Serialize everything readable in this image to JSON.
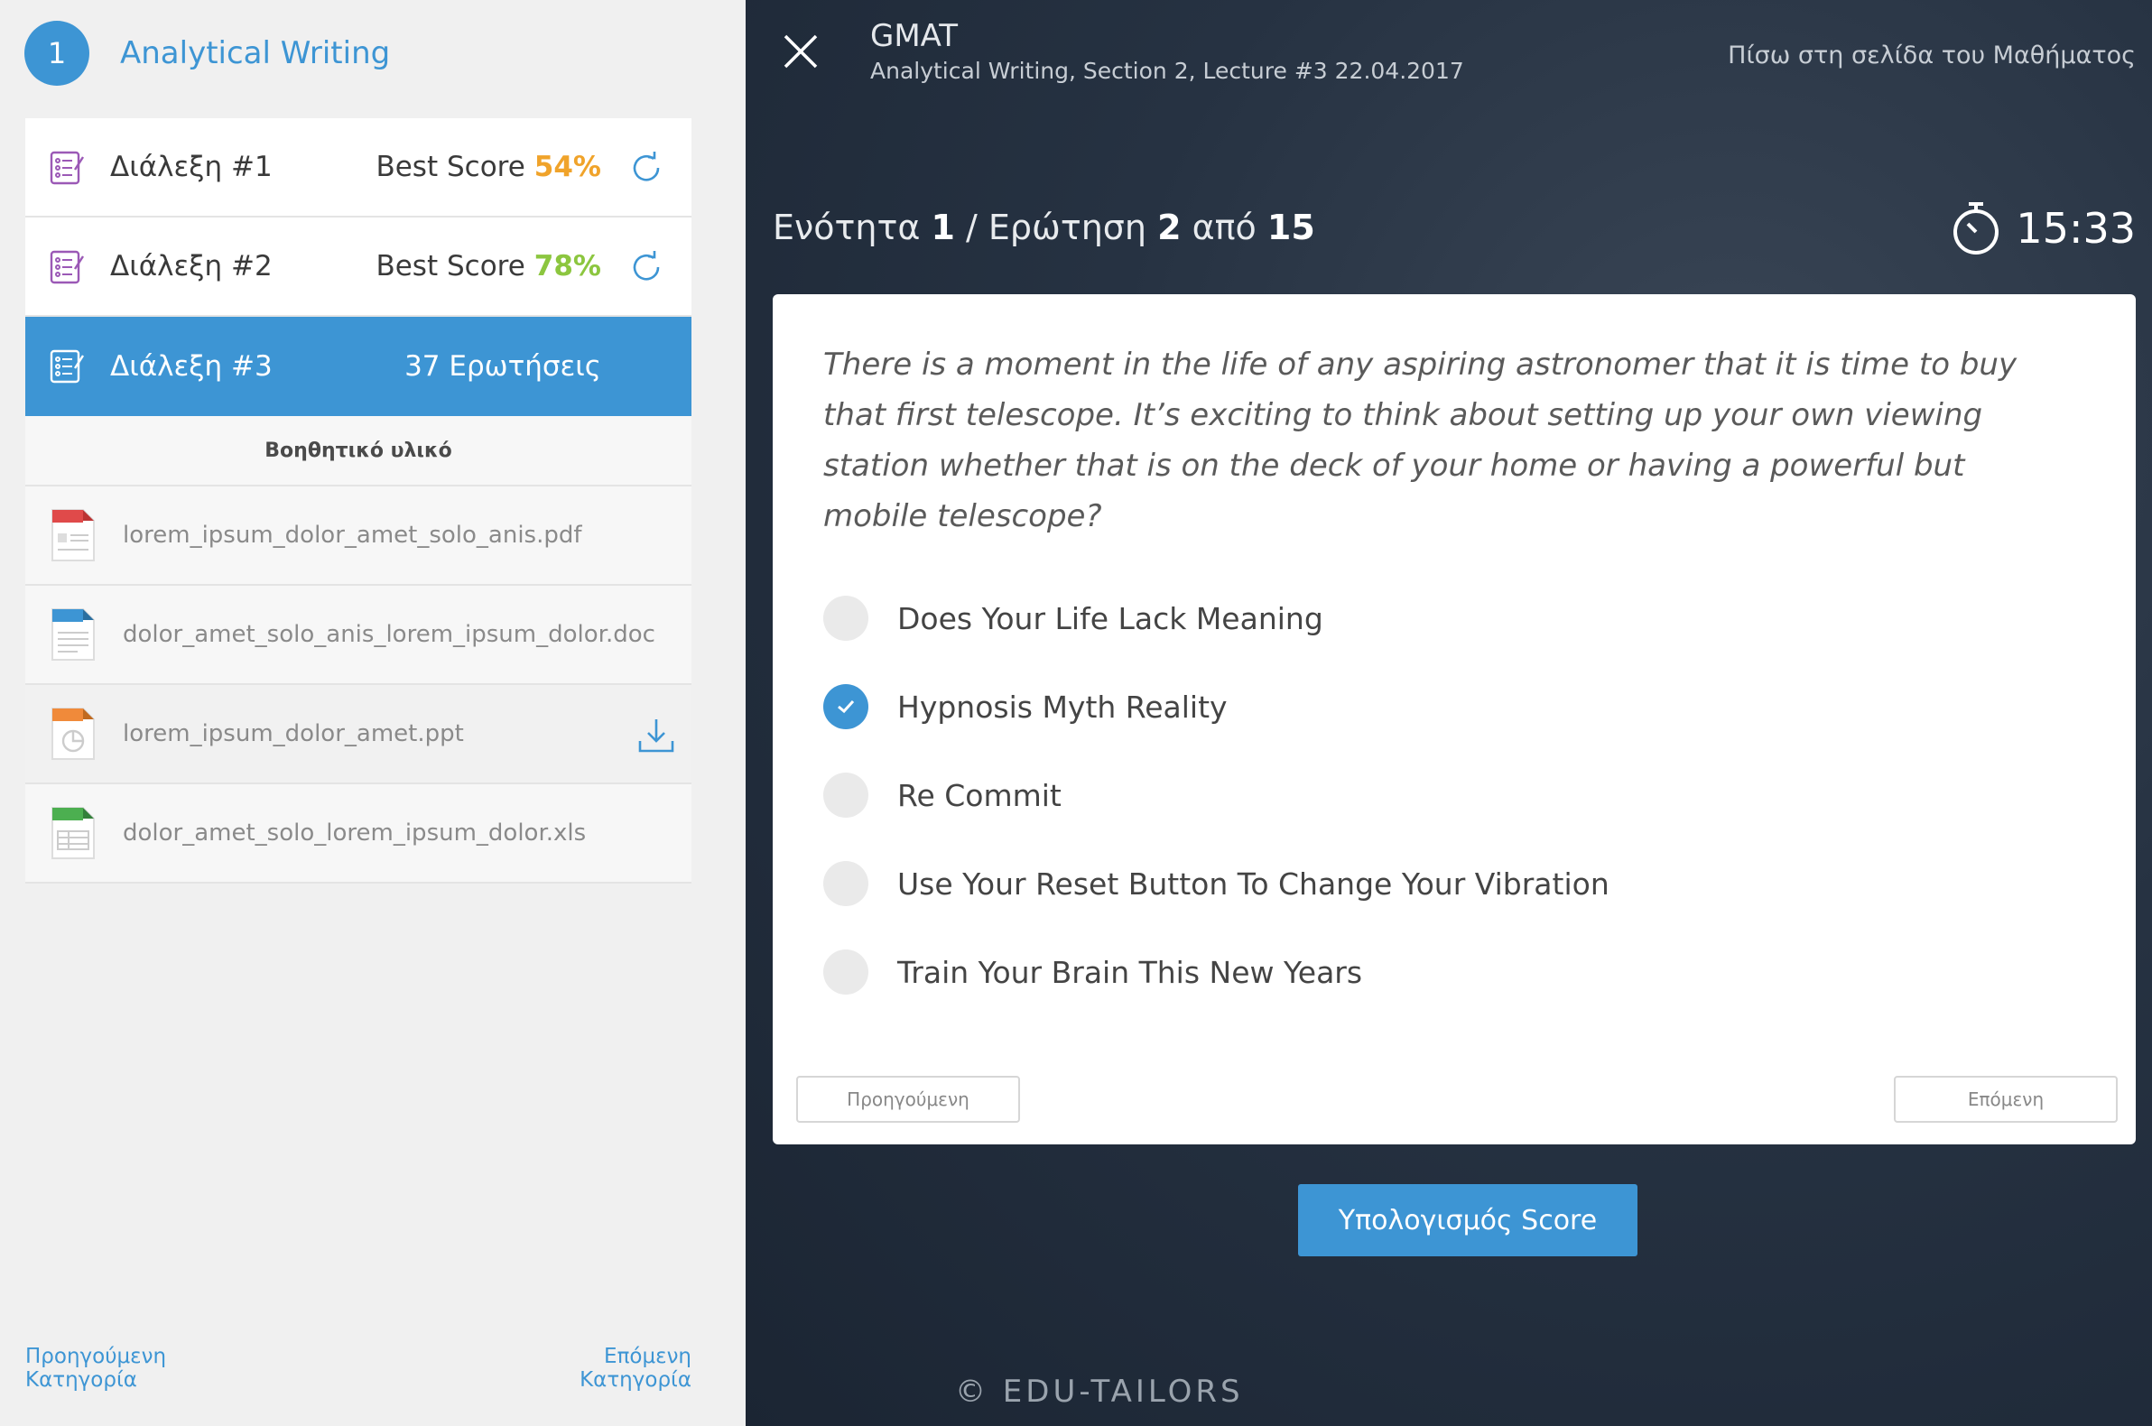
{
  "sidebar": {
    "section_number": "1",
    "section_title": "Analytical Writing",
    "lectures": [
      {
        "title": "Διάλεξη #1",
        "score_label": "Best Score",
        "score": "54%",
        "score_color": "#f0a32a"
      },
      {
        "title": "Διάλεξη #2",
        "score_label": "Best Score",
        "score": "78%",
        "score_color": "#8cc63f"
      },
      {
        "title": "Διάλεξη #3",
        "count": "37 Ερωτήσεις"
      }
    ],
    "materials_heading": "Βοηθητικό υλικό",
    "files": [
      {
        "name": "lorem_ipsum_dolor_amet_solo_anis.pdf",
        "type": "PDF",
        "color": "#e04a4a"
      },
      {
        "name": "dolor_amet_solo_anis_lorem_ipsum_dolor.doc",
        "type": "DOC",
        "color": "#3d95d4"
      },
      {
        "name": "lorem_ipsum_dolor_amet.ppt",
        "type": "PPT",
        "color": "#f08a3a"
      },
      {
        "name": "dolor_amet_solo_lorem_ipsum_dolor.xls",
        "type": "XLS",
        "color": "#4caf50"
      }
    ],
    "footer_prev_line1": "Προηγούμενη",
    "footer_prev_line2": "Κατηγορία",
    "footer_next_line1": "Επόμενη",
    "footer_next_line2": "Κατηγορία"
  },
  "header": {
    "title": "GMAT",
    "subtitle": "Analytical Writing, Section 2, Lecture #3 22.04.2017",
    "back_link": "Πίσω στη σελίδα του Μαθήματος"
  },
  "progress": {
    "section_label": "Ενότητα",
    "section_value": "1",
    "question_label": "/ Ερώτηση",
    "question_value": "2",
    "of_label": "από",
    "total_value": "15",
    "timer": "15:33"
  },
  "question": {
    "text": "There is a moment in the life of any aspiring astronomer that it is time to buy that first telescope. It’s exciting to think about setting up your own viewing station whether that is on the deck of your home or having a powerful but mobile telescope?",
    "options": [
      {
        "label": "Does Your Life Lack Meaning",
        "checked": false
      },
      {
        "label": "Hypnosis Myth Reality",
        "checked": true
      },
      {
        "label": "Re Commit",
        "checked": false
      },
      {
        "label": "Use Your Reset Button To Change Your Vibration",
        "checked": false
      },
      {
        "label": "Train Your Brain This New Years",
        "checked": false
      }
    ],
    "prev_button": "Προηγούμενη",
    "next_button": "Επόμενη"
  },
  "score_button": "Υπολογισμός Score",
  "brand": "© EDU-TAILORS",
  "colors": {
    "accent": "#3d95d4",
    "sidebar_bg": "#f0f0f0",
    "main_bg": "#263242"
  }
}
